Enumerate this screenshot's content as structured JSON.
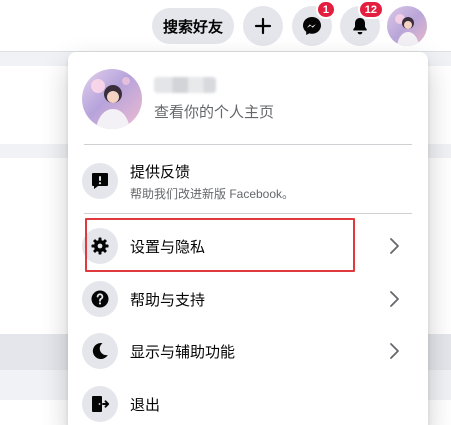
{
  "topbar": {
    "search_friends_label": "搜索好友",
    "messenger_badge": "1",
    "notifications_badge": "12"
  },
  "menu": {
    "profile": {
      "subtitle": "查看你的个人主页"
    },
    "feedback": {
      "label": "提供反馈",
      "sublabel": "帮助我们改进新版 Facebook。"
    },
    "items": [
      {
        "label": "设置与隐私",
        "icon": "gear-icon"
      },
      {
        "label": "帮助与支持",
        "icon": "question-icon"
      },
      {
        "label": "显示与辅助功能",
        "icon": "moon-icon"
      },
      {
        "label": "退出",
        "icon": "logout-icon"
      }
    ]
  },
  "colors": {
    "badge": "#e41e3f",
    "highlight": "#e0393e",
    "messenger": "#0a7cff"
  }
}
